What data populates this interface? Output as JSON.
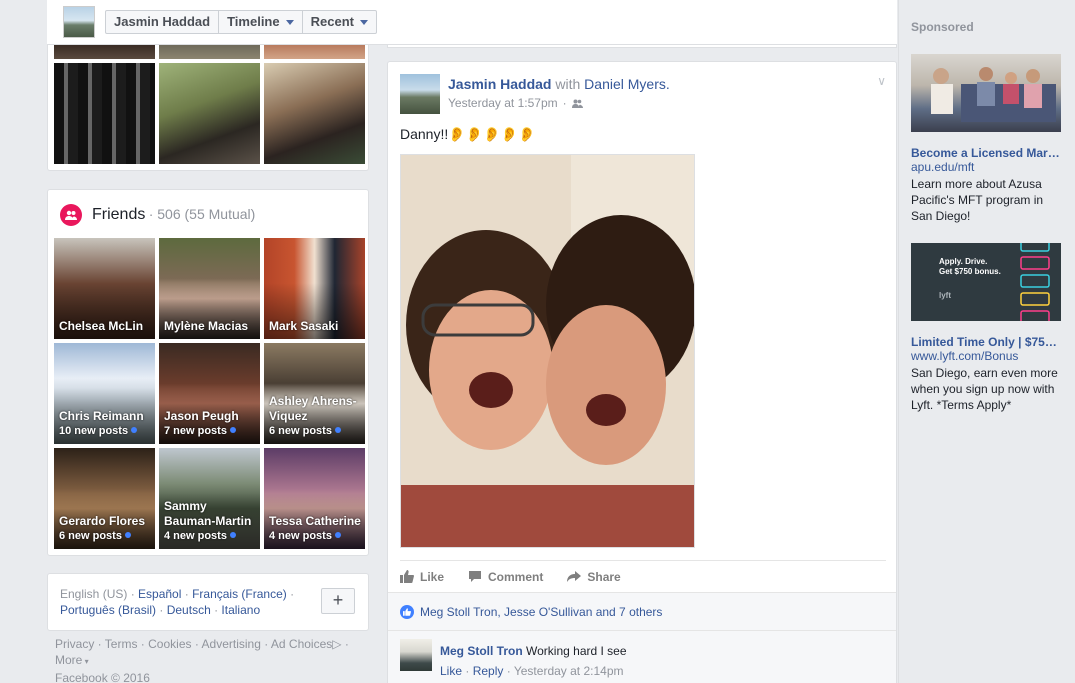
{
  "topbar": {
    "name_label": "Jasmin Haddad",
    "timeline_label": "Timeline",
    "recent_label": "Recent"
  },
  "friends": {
    "title": "Friends",
    "count": "· 506 (55 Mutual)",
    "items": [
      {
        "name": "Chelsea McLin",
        "posts": ""
      },
      {
        "name": "Mylène Macias",
        "posts": ""
      },
      {
        "name": "Mark Sasaki",
        "posts": ""
      },
      {
        "name": "Chris Reimann",
        "posts": "10 new posts"
      },
      {
        "name": "Jason Peugh",
        "posts": "7 new posts"
      },
      {
        "name": "Ashley Ahrens-Viquez",
        "posts": "6 new posts"
      },
      {
        "name": "Gerardo Flores",
        "posts": "6 new posts"
      },
      {
        "name": "Sammy Bauman-Martin",
        "posts": "4 new posts"
      },
      {
        "name": "Tessa Catherine",
        "posts": "4 new posts"
      }
    ]
  },
  "languages": {
    "current": "English (US)",
    "links": [
      "Español",
      "Français (France)",
      "Português (Brasil)",
      "Deutsch",
      "Italiano"
    ],
    "plus_label": "+"
  },
  "footer": {
    "links": [
      "Privacy",
      "Terms",
      "Cookies",
      "Advertising",
      "Ad Choices"
    ],
    "more": "More",
    "copyright": "Facebook © 2016"
  },
  "post": {
    "author": "Jasmin Haddad",
    "with_text": "with",
    "tagged": "Daniel Myers.",
    "timestamp": "Yesterday at 1:57pm",
    "text": "Danny!!👂👂👂👂👂",
    "actions": {
      "like": "Like",
      "comment": "Comment",
      "share": "Share"
    },
    "likes_summary": "Meg Stoll Tron, Jesse O'Sullivan and 7 others",
    "comment": {
      "author": "Meg Stoll Tron",
      "text": "Working hard I see",
      "like": "Like",
      "reply": "Reply",
      "time": "Yesterday at 2:14pm"
    }
  },
  "sponsored": {
    "title": "Sponsored",
    "ads": [
      {
        "title": "Become a Licensed Marria...",
        "url": "apu.edu/mft",
        "desc": "Learn more about Azusa Pacific's MFT program in San Diego!"
      },
      {
        "title": "Limited Time Only | $750 B...",
        "url": "www.lyft.com/Bonus",
        "desc": "San Diego, earn even more when you sign up now with Lyft. *Terms Apply*",
        "img_text_1": "Apply. Drive.",
        "img_text_2": "Get $750 bonus.",
        "img_brand": "lyft"
      }
    ]
  },
  "colors": {
    "link": "#365899",
    "friends_badge": "#e9175c",
    "new_post_dot": "#4080ff",
    "background": "#e9ebee"
  }
}
